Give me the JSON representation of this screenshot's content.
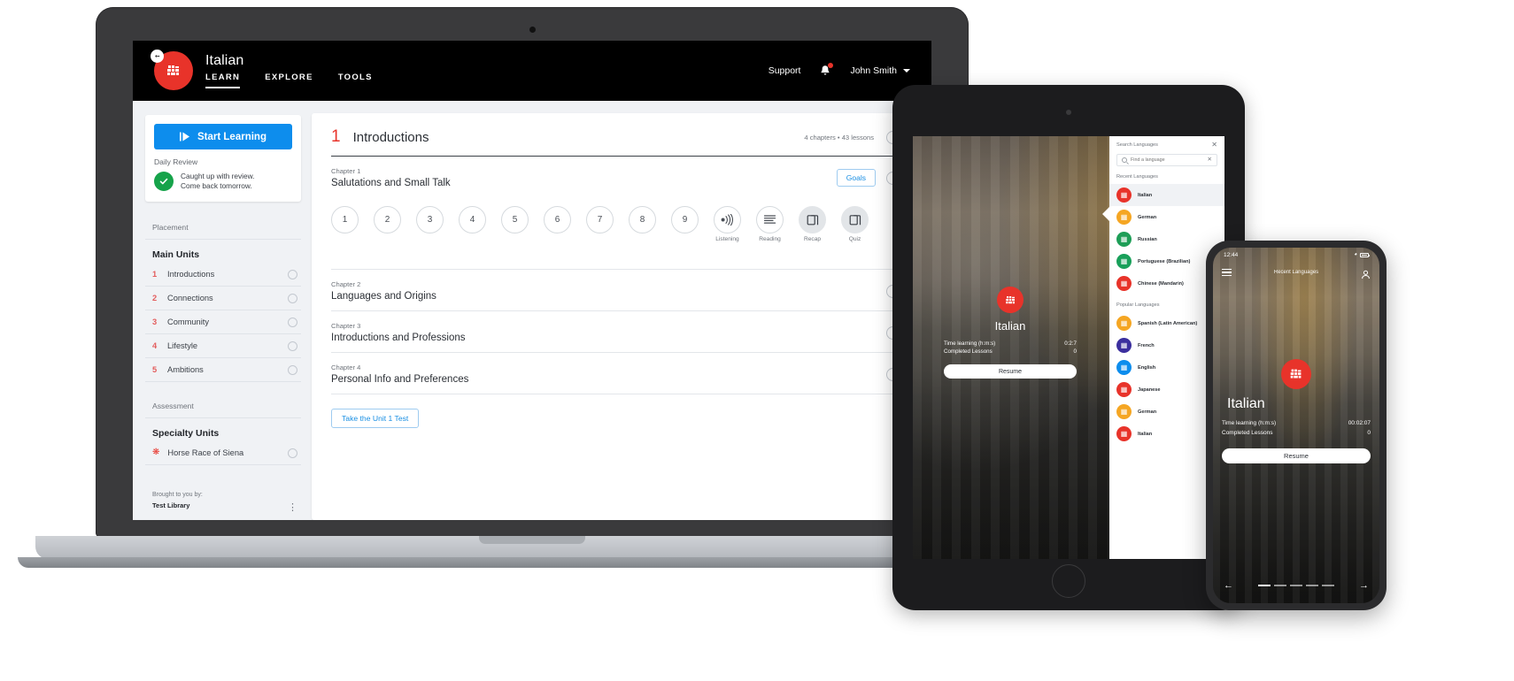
{
  "laptop": {
    "topbar": {
      "language": "Italian",
      "nav": [
        {
          "label": "LEARN",
          "active": true
        },
        {
          "label": "EXPLORE",
          "active": false
        },
        {
          "label": "TOOLS",
          "active": false
        }
      ],
      "support_label": "Support",
      "notification_icon": "bell-icon",
      "user_name": "John Smith"
    },
    "sidebar": {
      "start_button": "Start Learning",
      "daily_review_label": "Daily Review",
      "review_status_line1": "Caught up with review.",
      "review_status_line2": "Come back tomorrow.",
      "placement_label": "Placement",
      "main_units_heading": "Main Units",
      "units": [
        {
          "num": "1",
          "name": "Introductions"
        },
        {
          "num": "2",
          "name": "Connections"
        },
        {
          "num": "3",
          "name": "Community"
        },
        {
          "num": "4",
          "name": "Lifestyle"
        },
        {
          "num": "5",
          "name": "Ambitions"
        }
      ],
      "assessment_label": "Assessment",
      "specialty_heading": "Specialty Units",
      "specialty_items": [
        {
          "name": "Horse Race of Siena"
        }
      ],
      "footer_label": "Brought to you by:",
      "footer_org": "Test Library",
      "footer_menu_icon": "kebab-menu-icon"
    },
    "main": {
      "unit_number": "1",
      "unit_title": "Introductions",
      "unit_meta": "4 chapters • 43 lessons",
      "chapters": [
        {
          "label": "Chapter 1",
          "title": "Salutations and Small Talk",
          "goals_button": "Goals",
          "lessons": [
            "1",
            "2",
            "3",
            "4",
            "5",
            "6",
            "7",
            "8",
            "9"
          ],
          "activities": [
            {
              "caption": "Listening",
              "icon": "listening-icon",
              "filled": false
            },
            {
              "caption": "Reading",
              "icon": "reading-icon",
              "filled": false
            },
            {
              "caption": "Recap",
              "icon": "recap-icon",
              "filled": true
            },
            {
              "caption": "Quiz",
              "icon": "quiz-icon",
              "filled": true
            }
          ]
        },
        {
          "label": "Chapter 2",
          "title": "Languages and Origins"
        },
        {
          "label": "Chapter 3",
          "title": "Introductions and Professions"
        },
        {
          "label": "Chapter 4",
          "title": "Personal Info and Preferences"
        }
      ],
      "unit_test_button": "Take the Unit 1 Test"
    }
  },
  "tablet": {
    "language": "Italian",
    "stats": [
      {
        "label": "Time learning (h:m:s)",
        "value": "0:2:7"
      },
      {
        "label": "Completed Lessons",
        "value": "0"
      }
    ],
    "resume_button": "Resume",
    "drawer": {
      "title": "Search Languages",
      "close_icon": "close-icon",
      "search_placeholder": "Find a language",
      "search_value": "",
      "search_icon": "search-icon",
      "clear_icon": "clear-icon",
      "recent_heading": "Recent Languages",
      "recent": [
        {
          "name": "Italian",
          "color": "#e8332a",
          "selected": true
        },
        {
          "name": "German",
          "color": "#f5a623",
          "selected": false
        },
        {
          "name": "Russian",
          "color": "#1e9e57",
          "selected": false
        },
        {
          "name": "Portuguese (Brazilian)",
          "color": "#19a05a",
          "selected": false
        },
        {
          "name": "Chinese (Mandarin)",
          "color": "#e8332a",
          "selected": false
        }
      ],
      "popular_heading": "Popular Languages",
      "popular": [
        {
          "name": "Spanish (Latin American)",
          "color": "#f5a623"
        },
        {
          "name": "French",
          "color": "#3b2f9e"
        },
        {
          "name": "English",
          "color": "#0d8ded"
        },
        {
          "name": "Japanese",
          "color": "#e8332a"
        },
        {
          "name": "German",
          "color": "#f5a623"
        },
        {
          "name": "Italian",
          "color": "#e8332a"
        }
      ]
    }
  },
  "phone": {
    "status_time": "12:44",
    "wifi_icon": "wifi-icon",
    "battery_icon": "battery-icon",
    "nav_title": "Recent Languages",
    "menu_icon": "list-menu-icon",
    "profile_icon": "person-icon",
    "language": "Italian",
    "stats": [
      {
        "label": "Time learning (h:m:s)",
        "value": "00:02:07"
      },
      {
        "label": "Completed Lessons",
        "value": "0"
      }
    ],
    "resume_button": "Resume",
    "back_icon": "arrow-left-icon",
    "forward_icon": "arrow-right-icon",
    "pager_dots": 5,
    "pager_active": 0
  },
  "colors": {
    "brand_red": "#e8332a",
    "accent_blue": "#0d8ded",
    "success_green": "#16a34a",
    "topbar_black": "#000000",
    "page_bg": "#f0f2f5"
  }
}
